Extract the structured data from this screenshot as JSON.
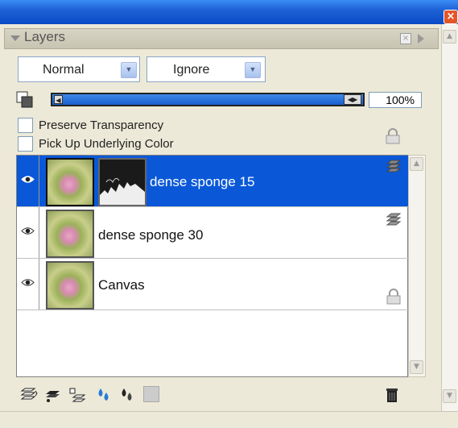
{
  "window": {
    "close_glyph": "×"
  },
  "panel": {
    "title": "Layers"
  },
  "blend": {
    "mode": "Normal",
    "composite": "Ignore"
  },
  "opacity": {
    "value_label": "100%",
    "value": 100
  },
  "options": {
    "preserve_transparency": {
      "label": "Preserve Transparency",
      "checked": false
    },
    "pick_up_color": {
      "label": "Pick Up Underlying Color",
      "checked": false
    }
  },
  "layers": [
    {
      "name": "dense sponge 15",
      "selected": true,
      "visible": true,
      "has_mask": true
    },
    {
      "name": "dense sponge 30",
      "selected": false,
      "visible": true,
      "has_mask": false
    },
    {
      "name": "Canvas",
      "selected": false,
      "visible": true,
      "locked": true
    }
  ],
  "toolbar": {
    "icons": [
      "layer-options-icon",
      "new-layer-icon",
      "new-group-icon",
      "water-layer-icon",
      "liquid-ink-icon",
      "dynamic-plugins-icon",
      "delete-layer-icon"
    ]
  },
  "colors": {
    "selection": "#0a58d8",
    "accent": "#316ac5"
  }
}
